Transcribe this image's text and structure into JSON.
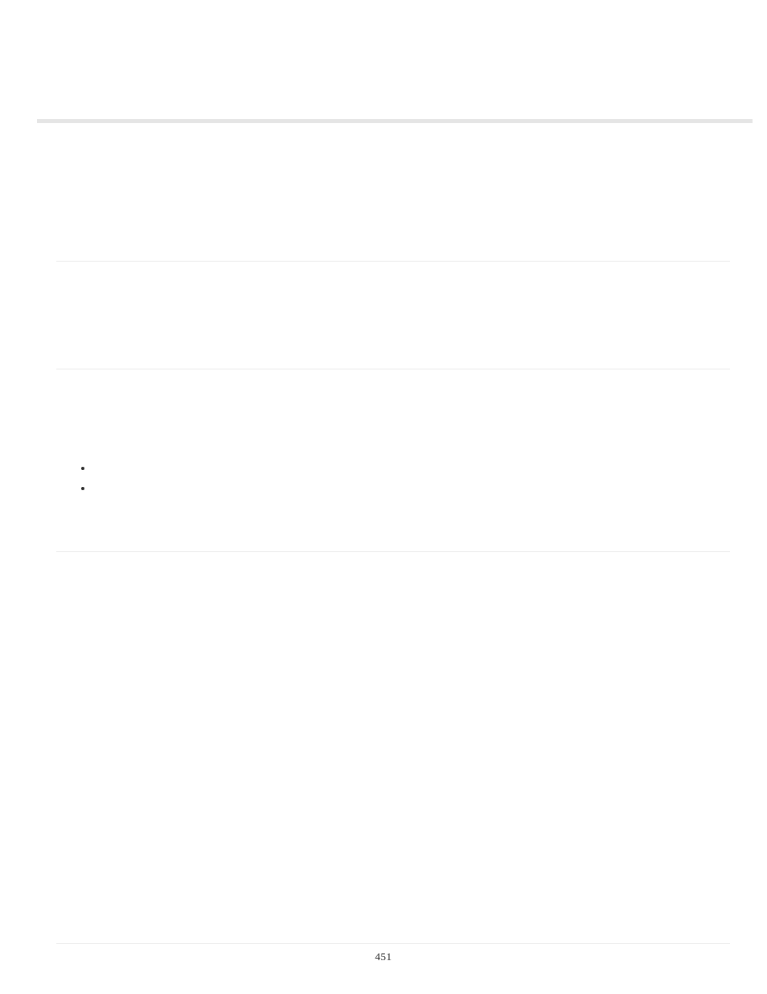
{
  "page_number": "451",
  "bullets": [
    "",
    ""
  ]
}
